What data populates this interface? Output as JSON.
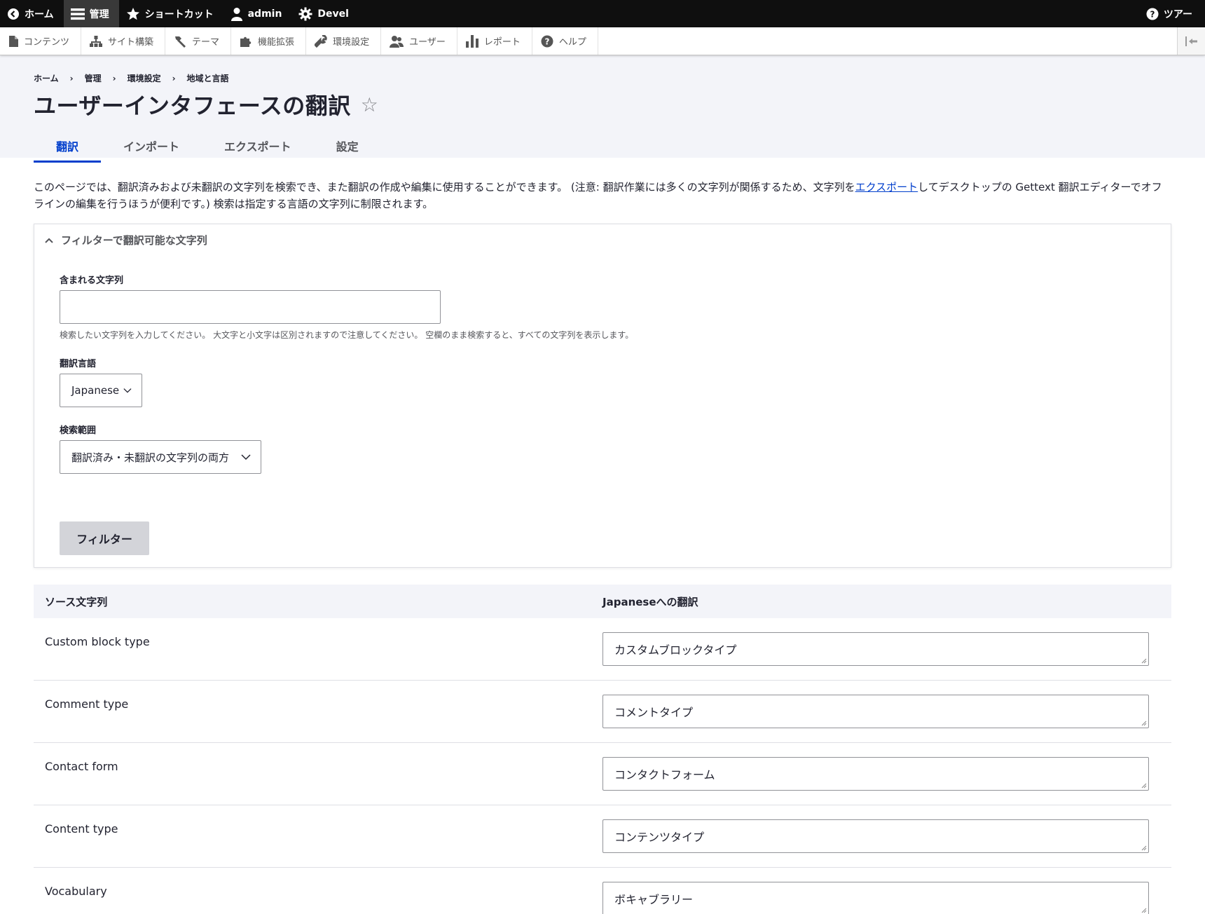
{
  "toolbar": {
    "home": "ホーム",
    "manage": "管理",
    "shortcuts": "ショートカット",
    "user": "admin",
    "devel": "Devel",
    "tour": "ツアー"
  },
  "tray": {
    "items": [
      {
        "label": "コンテンツ",
        "icon": "file-icon"
      },
      {
        "label": "サイト構築",
        "icon": "sitemap-icon"
      },
      {
        "label": "テーマ",
        "icon": "paintbrush-icon"
      },
      {
        "label": "機能拡張",
        "icon": "puzzle-icon"
      },
      {
        "label": "環境設定",
        "icon": "wrench-icon"
      },
      {
        "label": "ユーザー",
        "icon": "people-icon"
      },
      {
        "label": "レポート",
        "icon": "bar-chart-icon"
      },
      {
        "label": "ヘルプ",
        "icon": "help-icon"
      }
    ]
  },
  "breadcrumb": [
    "ホーム",
    "管理",
    "環境設定",
    "地域と言語"
  ],
  "page": {
    "title": "ユーザーインタフェースの翻訳"
  },
  "tabs": [
    "翻訳",
    "インポート",
    "エクスポート",
    "設定"
  ],
  "intro": {
    "before": "このページでは、翻訳済みおよび未翻訳の文字列を検索でき、また翻訳の作成や編集に使用することができます。 (注意: 翻訳作業には多くの文字列が関係するため、文字列を",
    "link": "エクスポート",
    "after": "してデスクトップの Gettext 翻訳エディターでオフラインの編集を行うほうが便利です。) 検索は指定する言語の文字列に制限されます。"
  },
  "filter": {
    "summary": "フィルターで翻訳可能な文字列",
    "contains_label": "含まれる文字列",
    "contains_value": "",
    "contains_desc": "検索したい文字列を入力してください。 大文字と小文字は区別されますので注意してください。 空欄のまま検索すると、すべての文字列を表示します。",
    "language_label": "翻訳言語",
    "language_value": "Japanese",
    "scope_label": "検索範囲",
    "scope_value": "翻訳済み・未翻訳の文字列の両方",
    "button": "フィルター"
  },
  "table": {
    "col_source": "ソース文字列",
    "col_translation": "Japaneseへの翻訳",
    "rows": [
      {
        "source": "Custom block type",
        "translation": "カスタムブロックタイプ"
      },
      {
        "source": "Comment type",
        "translation": "コメントタイプ"
      },
      {
        "source": "Contact form",
        "translation": "コンタクトフォーム"
      },
      {
        "source": "Content type",
        "translation": "コンテンツタイプ"
      },
      {
        "source": "Vocabulary",
        "translation": "ボキャブラリー"
      }
    ]
  }
}
